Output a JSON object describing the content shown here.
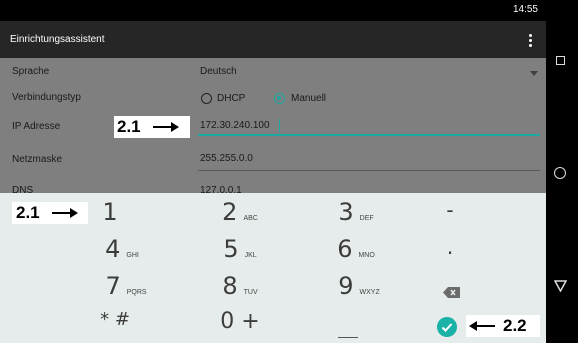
{
  "status_bar": {
    "time": "14:55"
  },
  "app_bar": {
    "title": "Einrichtungsassistent",
    "menu_icon": "overflow-menu-icon"
  },
  "form": {
    "language": {
      "label": "Sprache",
      "value": "Deutsch"
    },
    "connection_type": {
      "label": "Verbindungstyp",
      "option_dhcp": "DHCP",
      "option_manual": "Manuell",
      "selected": "Manuell"
    },
    "ip_address": {
      "label": "IP Adresse",
      "value": "172.30.240.100"
    },
    "netmask": {
      "label": "Netzmaske",
      "value": "255.255.0.0"
    },
    "dns": {
      "label": "DNS",
      "value": "127.0.0.1"
    }
  },
  "callouts": {
    "ip_field": "2.1",
    "keypad": "2.1",
    "done": "2.2"
  },
  "keypad": {
    "keys": [
      {
        "num": "1",
        "letters": ""
      },
      {
        "num": "2",
        "letters": "ABC"
      },
      {
        "num": "3",
        "letters": "DEF"
      },
      {
        "num": "-",
        "letters": ""
      },
      {
        "num": "4",
        "letters": "GHI"
      },
      {
        "num": "5",
        "letters": "JKL"
      },
      {
        "num": "6",
        "letters": "MNO"
      },
      {
        "num": ".",
        "letters": ""
      },
      {
        "num": "7",
        "letters": "PQRS"
      },
      {
        "num": "8",
        "letters": "TUV"
      },
      {
        "num": "9",
        "letters": "WXYZ"
      },
      {
        "num": "* #",
        "letters": ""
      },
      {
        "num": "0 +",
        "letters": ""
      }
    ],
    "backspace_icon": "backspace-icon",
    "done_icon": "checkmark-circle-icon"
  },
  "nav_bar": {
    "icons": [
      "recents-icon",
      "home-icon",
      "back-icon"
    ]
  },
  "colors": {
    "accent": "#1aa8a0",
    "dim_overlay": "#7f7f7f",
    "keypad_bg": "#e6eceb",
    "app_bar": "#262626"
  }
}
